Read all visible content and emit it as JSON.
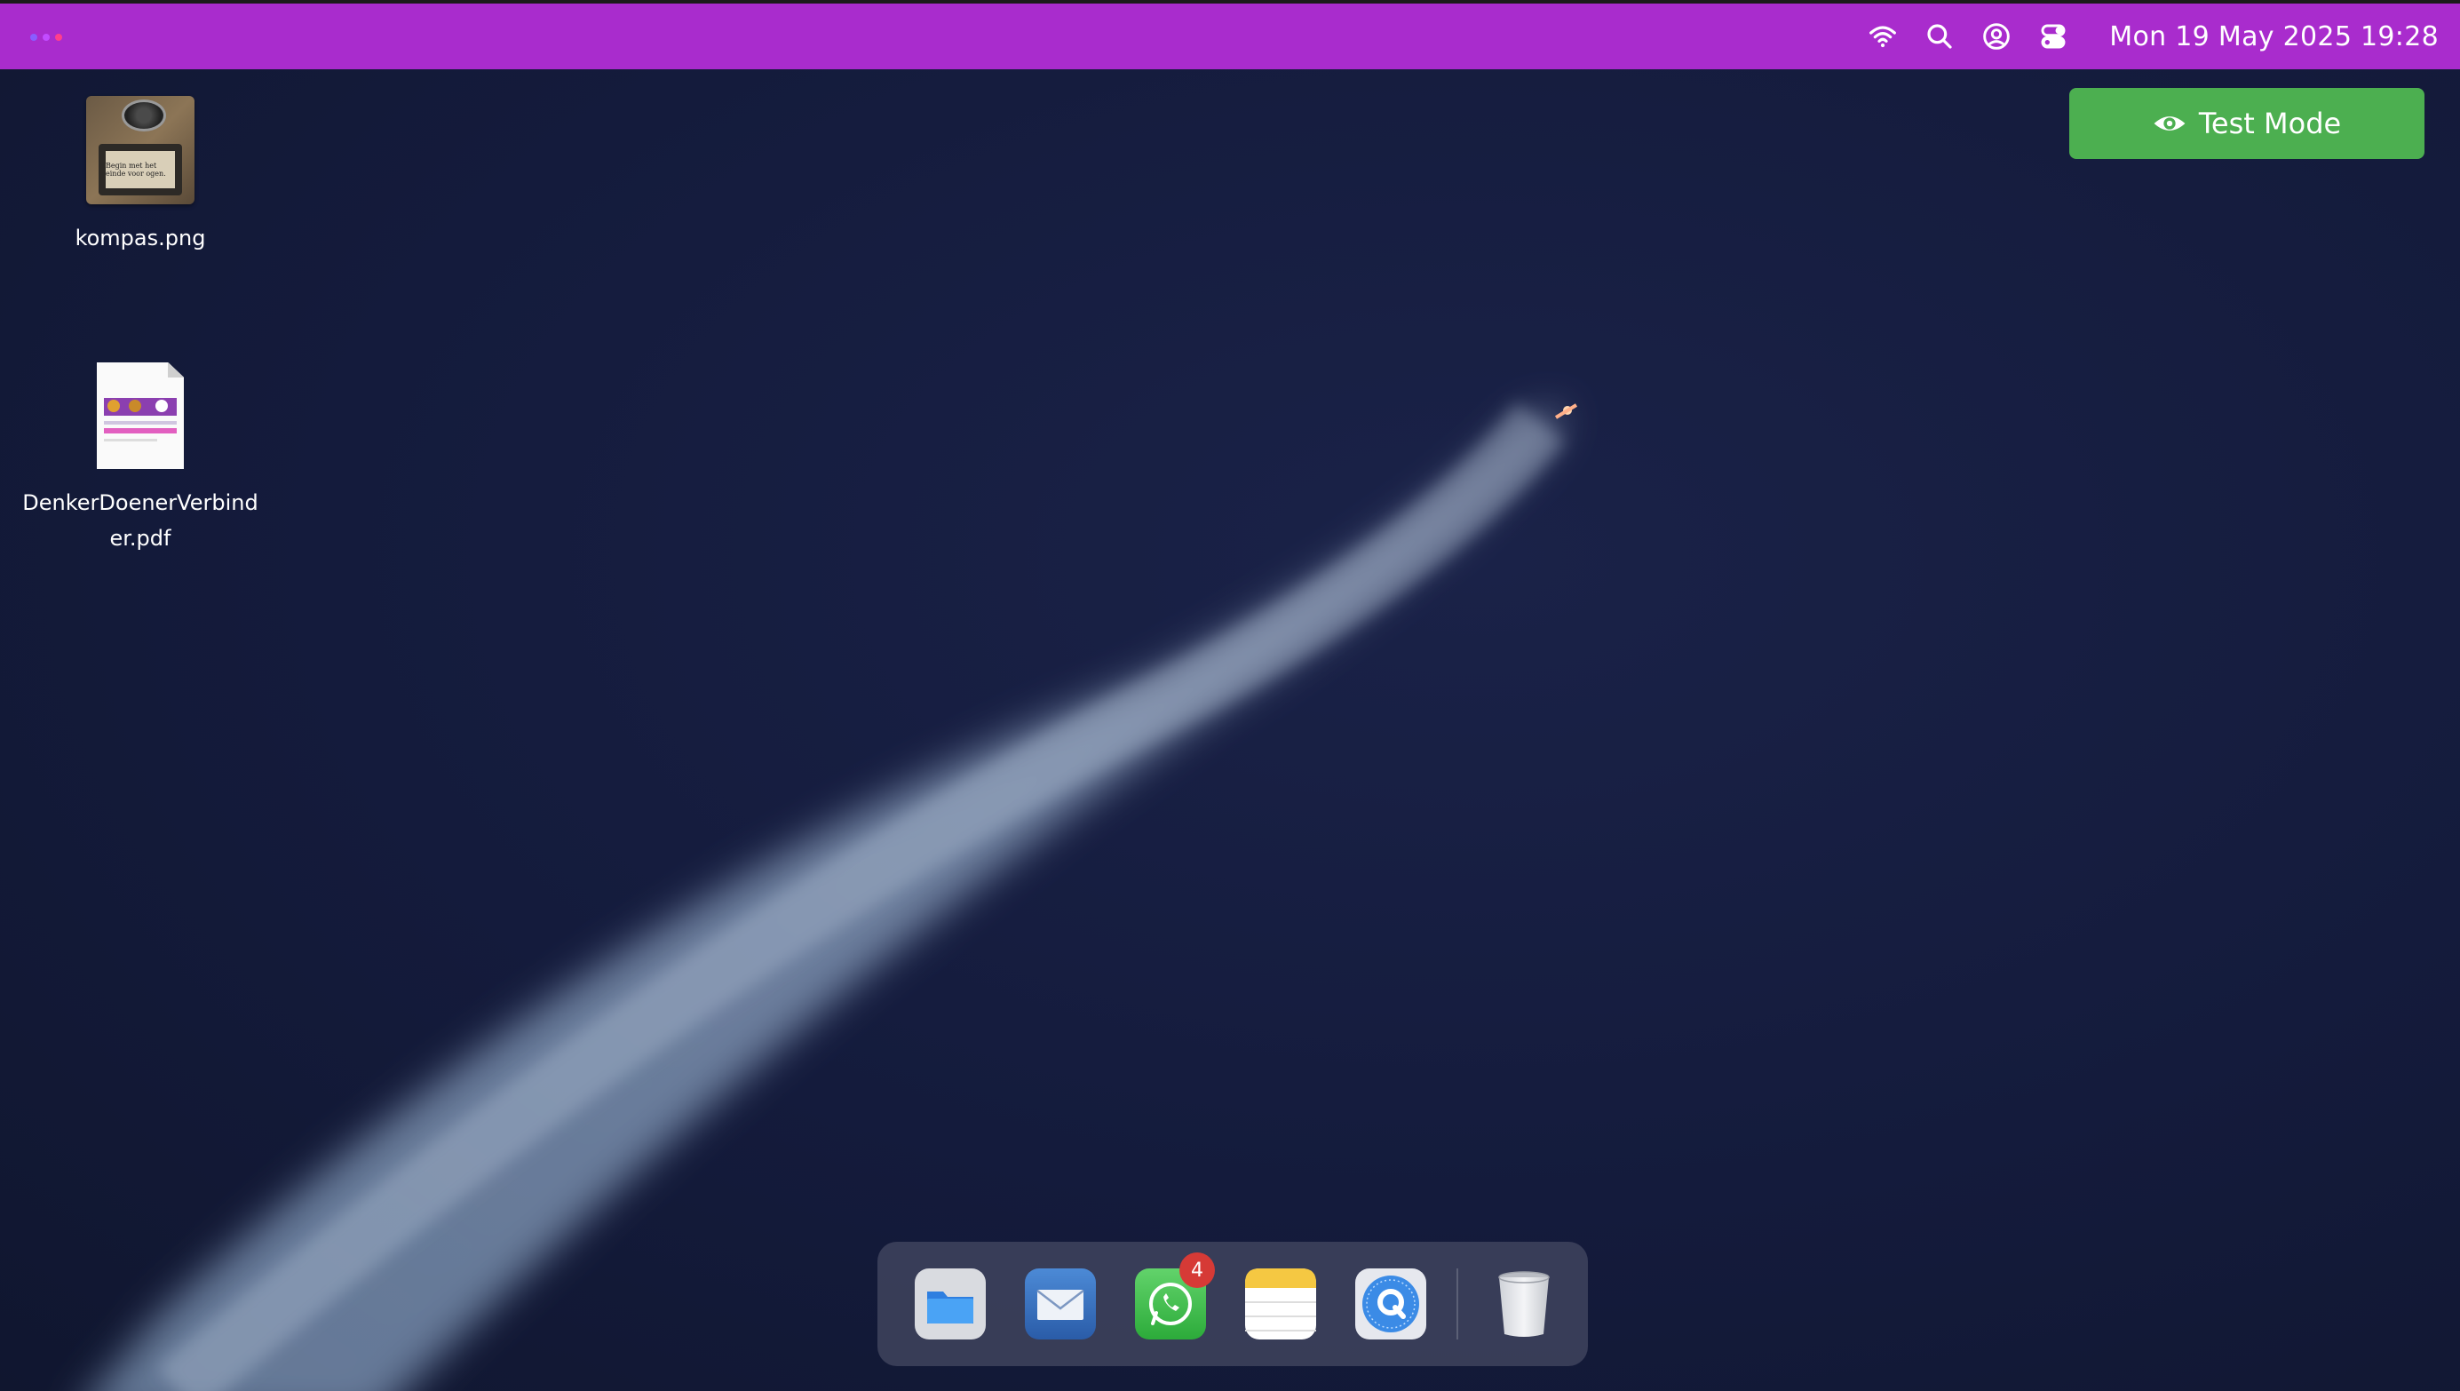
{
  "topbar": {
    "clock": "Mon 19 May 2025 19:28",
    "icons": [
      "wifi-icon",
      "search-icon",
      "user-icon",
      "toggle-icon"
    ],
    "color": "#a92ccd"
  },
  "test_mode": {
    "label": "Test Mode",
    "color": "#4caf50"
  },
  "desktop": {
    "items": [
      {
        "label": "kompas.png",
        "thumb_text": "Begin met het einde voor ogen."
      },
      {
        "label": "DenkerDoenerVerbinder.pdf"
      }
    ]
  },
  "dock": {
    "apps": [
      {
        "name": "Files",
        "icon": "folder-icon"
      },
      {
        "name": "Mail",
        "icon": "mail-icon"
      },
      {
        "name": "WhatsApp",
        "icon": "whatsapp-icon",
        "badge": "4"
      },
      {
        "name": "Notes",
        "icon": "notes-icon"
      },
      {
        "name": "Quiz",
        "icon": "q-badge-icon"
      },
      {
        "name": "Trash",
        "icon": "trash-icon"
      }
    ]
  }
}
